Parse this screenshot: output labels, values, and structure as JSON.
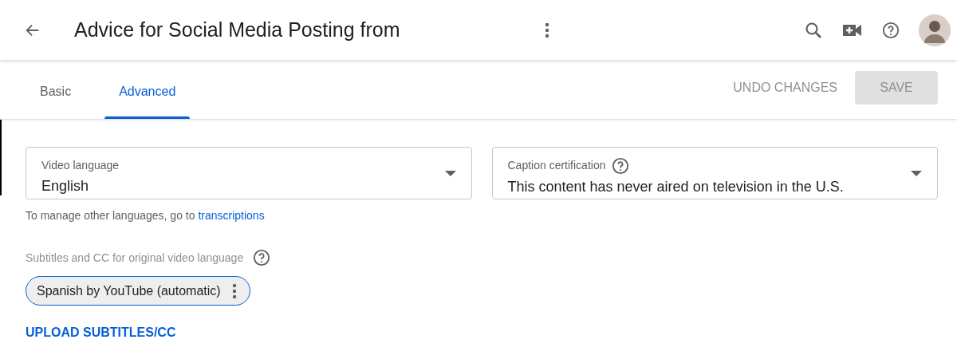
{
  "header": {
    "title": "Advice for Social Media Posting from"
  },
  "tabs": [
    {
      "label": "Basic",
      "selected": false
    },
    {
      "label": "Advanced",
      "selected": true
    }
  ],
  "actions": {
    "undo": {
      "label": "UNDO CHANGES",
      "disabled": true
    },
    "save": {
      "label": "SAVE",
      "disabled": true
    }
  },
  "fields": [
    {
      "label": "Video language",
      "value": "English",
      "help": false
    },
    {
      "label": "Caption certification",
      "value": "This content has never aired on television in the U.S.",
      "help": true
    }
  ],
  "language_hint": {
    "text": "To manage other languages, go to ",
    "link": "transcriptions"
  },
  "subtitles": {
    "label": "Subtitles and CC for original video language",
    "tracks": [
      {
        "label": "Spanish by YouTube (automatic)"
      }
    ],
    "upload": "UPLOAD SUBTITLES/CC"
  }
}
